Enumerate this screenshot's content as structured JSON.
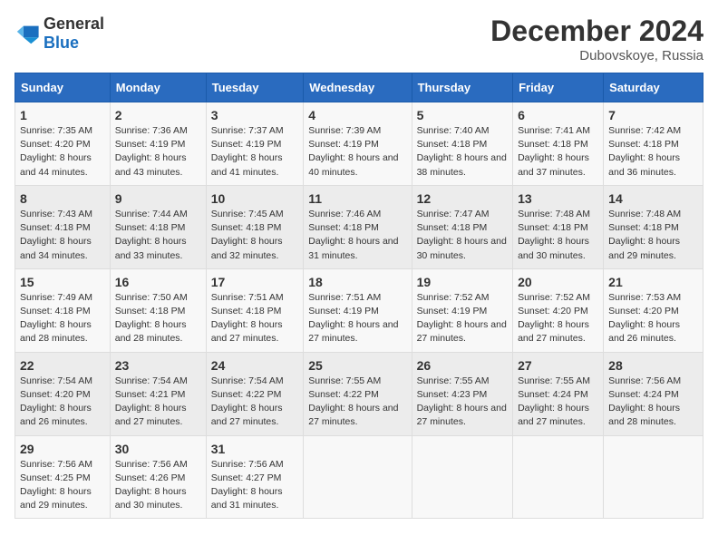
{
  "header": {
    "logo_general": "General",
    "logo_blue": "Blue",
    "main_title": "December 2024",
    "subtitle": "Dubovskoye, Russia"
  },
  "days_of_week": [
    "Sunday",
    "Monday",
    "Tuesday",
    "Wednesday",
    "Thursday",
    "Friday",
    "Saturday"
  ],
  "weeks": [
    [
      {
        "day": "1",
        "sunrise": "7:35 AM",
        "sunset": "4:20 PM",
        "daylight": "8 hours and 44 minutes."
      },
      {
        "day": "2",
        "sunrise": "7:36 AM",
        "sunset": "4:19 PM",
        "daylight": "8 hours and 43 minutes."
      },
      {
        "day": "3",
        "sunrise": "7:37 AM",
        "sunset": "4:19 PM",
        "daylight": "8 hours and 41 minutes."
      },
      {
        "day": "4",
        "sunrise": "7:39 AM",
        "sunset": "4:19 PM",
        "daylight": "8 hours and 40 minutes."
      },
      {
        "day": "5",
        "sunrise": "7:40 AM",
        "sunset": "4:18 PM",
        "daylight": "8 hours and 38 minutes."
      },
      {
        "day": "6",
        "sunrise": "7:41 AM",
        "sunset": "4:18 PM",
        "daylight": "8 hours and 37 minutes."
      },
      {
        "day": "7",
        "sunrise": "7:42 AM",
        "sunset": "4:18 PM",
        "daylight": "8 hours and 36 minutes."
      }
    ],
    [
      {
        "day": "8",
        "sunrise": "7:43 AM",
        "sunset": "4:18 PM",
        "daylight": "8 hours and 34 minutes."
      },
      {
        "day": "9",
        "sunrise": "7:44 AM",
        "sunset": "4:18 PM",
        "daylight": "8 hours and 33 minutes."
      },
      {
        "day": "10",
        "sunrise": "7:45 AM",
        "sunset": "4:18 PM",
        "daylight": "8 hours and 32 minutes."
      },
      {
        "day": "11",
        "sunrise": "7:46 AM",
        "sunset": "4:18 PM",
        "daylight": "8 hours and 31 minutes."
      },
      {
        "day": "12",
        "sunrise": "7:47 AM",
        "sunset": "4:18 PM",
        "daylight": "8 hours and 30 minutes."
      },
      {
        "day": "13",
        "sunrise": "7:48 AM",
        "sunset": "4:18 PM",
        "daylight": "8 hours and 30 minutes."
      },
      {
        "day": "14",
        "sunrise": "7:48 AM",
        "sunset": "4:18 PM",
        "daylight": "8 hours and 29 minutes."
      }
    ],
    [
      {
        "day": "15",
        "sunrise": "7:49 AM",
        "sunset": "4:18 PM",
        "daylight": "8 hours and 28 minutes."
      },
      {
        "day": "16",
        "sunrise": "7:50 AM",
        "sunset": "4:18 PM",
        "daylight": "8 hours and 28 minutes."
      },
      {
        "day": "17",
        "sunrise": "7:51 AM",
        "sunset": "4:18 PM",
        "daylight": "8 hours and 27 minutes."
      },
      {
        "day": "18",
        "sunrise": "7:51 AM",
        "sunset": "4:19 PM",
        "daylight": "8 hours and 27 minutes."
      },
      {
        "day": "19",
        "sunrise": "7:52 AM",
        "sunset": "4:19 PM",
        "daylight": "8 hours and 27 minutes."
      },
      {
        "day": "20",
        "sunrise": "7:52 AM",
        "sunset": "4:20 PM",
        "daylight": "8 hours and 27 minutes."
      },
      {
        "day": "21",
        "sunrise": "7:53 AM",
        "sunset": "4:20 PM",
        "daylight": "8 hours and 26 minutes."
      }
    ],
    [
      {
        "day": "22",
        "sunrise": "7:54 AM",
        "sunset": "4:20 PM",
        "daylight": "8 hours and 26 minutes."
      },
      {
        "day": "23",
        "sunrise": "7:54 AM",
        "sunset": "4:21 PM",
        "daylight": "8 hours and 27 minutes."
      },
      {
        "day": "24",
        "sunrise": "7:54 AM",
        "sunset": "4:22 PM",
        "daylight": "8 hours and 27 minutes."
      },
      {
        "day": "25",
        "sunrise": "7:55 AM",
        "sunset": "4:22 PM",
        "daylight": "8 hours and 27 minutes."
      },
      {
        "day": "26",
        "sunrise": "7:55 AM",
        "sunset": "4:23 PM",
        "daylight": "8 hours and 27 minutes."
      },
      {
        "day": "27",
        "sunrise": "7:55 AM",
        "sunset": "4:24 PM",
        "daylight": "8 hours and 27 minutes."
      },
      {
        "day": "28",
        "sunrise": "7:56 AM",
        "sunset": "4:24 PM",
        "daylight": "8 hours and 28 minutes."
      }
    ],
    [
      {
        "day": "29",
        "sunrise": "7:56 AM",
        "sunset": "4:25 PM",
        "daylight": "8 hours and 29 minutes."
      },
      {
        "day": "30",
        "sunrise": "7:56 AM",
        "sunset": "4:26 PM",
        "daylight": "8 hours and 30 minutes."
      },
      {
        "day": "31",
        "sunrise": "7:56 AM",
        "sunset": "4:27 PM",
        "daylight": "8 hours and 31 minutes."
      },
      null,
      null,
      null,
      null
    ]
  ]
}
